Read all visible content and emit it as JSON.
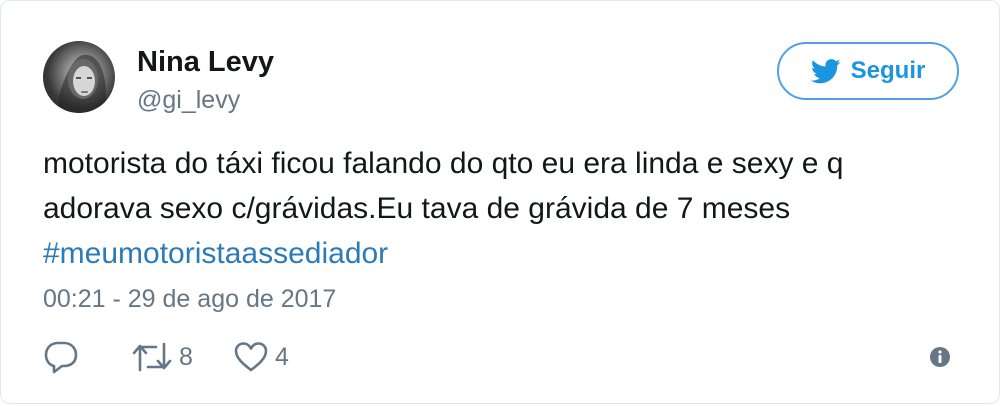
{
  "tweet": {
    "author": {
      "name": "Nina Levy",
      "handle": "@gi_levy",
      "avatar_icon": "avatar-photo"
    },
    "follow_button": {
      "label": "Seguir",
      "icon": "twitter-bird-icon",
      "color": "#1b95e0"
    },
    "text_lines": [
      "motorista do táxi ficou falando do qto eu era linda e sexy e q",
      "adorava sexo c/grávidas.Eu tava de grávida de 7 meses"
    ],
    "hashtag": "#meumotoristaassediador",
    "timestamp": "00:21 - 29 de ago de 2017",
    "actions": {
      "reply": {
        "icon": "reply-icon",
        "count": ""
      },
      "retweet": {
        "icon": "retweet-icon",
        "count": "8"
      },
      "like": {
        "icon": "heart-icon",
        "count": "4"
      },
      "info": {
        "icon": "info-icon"
      }
    }
  },
  "colors": {
    "text": "#14171a",
    "secondary": "#657786",
    "link": "#2b7bb9",
    "border": "#e1e8ed"
  }
}
